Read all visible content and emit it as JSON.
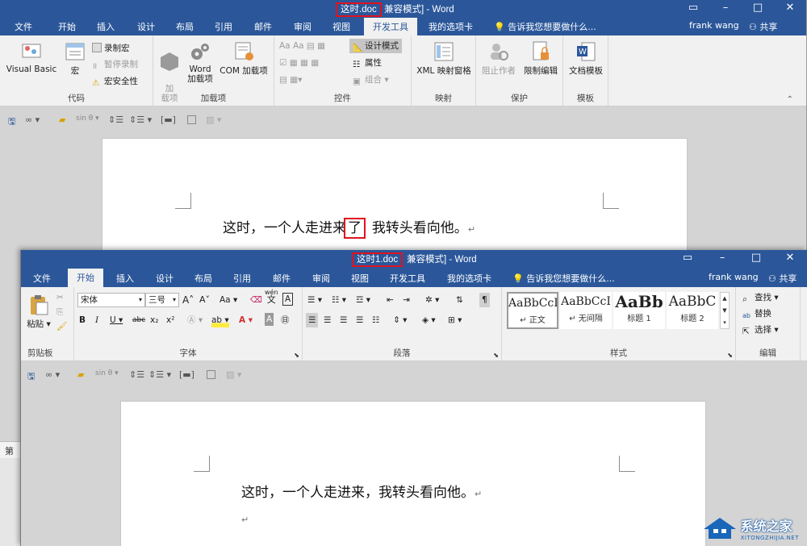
{
  "window_back": {
    "title_highlight": "这时.doc",
    "title_rest": "兼容模式] - Word",
    "tabs": [
      "文件",
      "开始",
      "插入",
      "设计",
      "布局",
      "引用",
      "邮件",
      "审阅",
      "视图",
      "开发工具",
      "我的选项卡"
    ],
    "active_tab": "开发工具",
    "tell_me": "告诉我您想要做什么...",
    "user": "frank wang",
    "share": "共享",
    "groups": {
      "code": {
        "label": "代码",
        "visual_basic": "Visual Basic",
        "macro": "宏",
        "record": "录制宏",
        "pause": "暂停录制",
        "security": "宏安全性"
      },
      "addins": {
        "label": "加载项",
        "addin": "加\n载项",
        "word_addin_1": "Word",
        "word_addin_2": "加载项",
        "com_addin": "COM 加载项"
      },
      "controls": {
        "label": "控件",
        "design_mode": "设计模式",
        "properties": "属性",
        "group": "组合"
      },
      "mapping": {
        "label": "映射",
        "xml": "XML 映射窗格"
      },
      "protect": {
        "label": "保护",
        "block_authors": "阻止作者",
        "restrict": "限制编辑"
      },
      "templates": {
        "label": "模板",
        "doc_template": "文档模板"
      }
    },
    "qat_sin": "sin θ",
    "document": {
      "before": "这时，一个人走进来",
      "highlight": "了",
      "after": "我转头看向他。",
      "mark": "↵"
    },
    "status_left": "第"
  },
  "window_front": {
    "title_highlight": "这时1.doc",
    "title_rest": "兼容模式] - Word",
    "tabs": [
      "文件",
      "开始",
      "插入",
      "设计",
      "布局",
      "引用",
      "邮件",
      "审阅",
      "视图",
      "开发工具",
      "我的选项卡"
    ],
    "active_tab": "开始",
    "tell_me": "告诉我您想要做什么...",
    "user": "frank wang",
    "share": "共享",
    "groups": {
      "clipboard": {
        "label": "剪贴板",
        "paste": "粘贴"
      },
      "font": {
        "label": "字体",
        "font_name": "宋体",
        "font_size": "三号",
        "wen": "wén",
        "wen_char": "文"
      },
      "paragraph": {
        "label": "段落"
      },
      "styles": {
        "label": "样式",
        "items": [
          {
            "preview": "AaBbCcI",
            "caption": "↵ 正文"
          },
          {
            "preview": "AaBbCcI",
            "caption": "↵ 无间隔"
          },
          {
            "preview": "AaBb",
            "caption": "标题 1"
          },
          {
            "preview": "AaBbC",
            "caption": "标题 2"
          }
        ]
      },
      "editing": {
        "label": "编辑",
        "find": "查找",
        "replace": "替换",
        "select": "选择"
      }
    },
    "qat_sin": "sin θ",
    "document": {
      "line1": "这时，一个人走进来，我转头看向他。",
      "mark": "↵"
    }
  },
  "watermark": {
    "name": "系统之家",
    "url": "XITONGZHIJIA.NET"
  },
  "colors": {
    "title_bar": "#2b579a",
    "highlight": "#e0121f",
    "ribbon": "#f1f1f1"
  }
}
